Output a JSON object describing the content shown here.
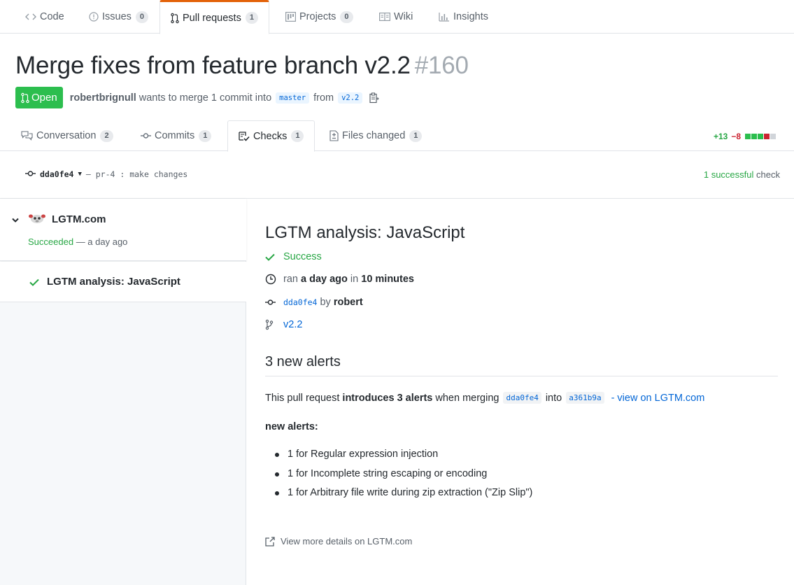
{
  "repo_nav": {
    "tabs": [
      {
        "label": "Code",
        "icon": "code-icon",
        "count": null
      },
      {
        "label": "Issues",
        "icon": "issue-icon",
        "count": "0"
      },
      {
        "label": "Pull requests",
        "icon": "pull-request-icon",
        "count": "1",
        "selected": true
      },
      {
        "label": "Projects",
        "icon": "project-icon",
        "count": "0"
      },
      {
        "label": "Wiki",
        "icon": "book-icon",
        "count": null
      },
      {
        "label": "Insights",
        "icon": "graph-icon",
        "count": null
      }
    ]
  },
  "pr": {
    "title": "Merge fixes from feature branch v2.2",
    "number": "#160",
    "state": "Open",
    "author": "robertbrignull",
    "merge_text": "wants to merge 1 commit into",
    "base_branch": "master",
    "from_text": "from",
    "head_branch": "v2.2"
  },
  "pr_tabs": [
    {
      "label": "Conversation",
      "icon": "comment-discussion-icon",
      "count": "2"
    },
    {
      "label": "Commits",
      "icon": "git-commit-icon",
      "count": "1"
    },
    {
      "label": "Checks",
      "icon": "checklist-icon",
      "count": "1",
      "selected": true
    },
    {
      "label": "Files changed",
      "icon": "file-diff-icon",
      "count": "1"
    }
  ],
  "diffstat": {
    "additions": "+13",
    "deletions": "−8",
    "colors": {
      "add": "#2cbe4e",
      "del": "#cb2431",
      "neutral": "#d1d5da"
    }
  },
  "commit_bar": {
    "sha": "dda0fe4",
    "message": "— pr-4 : make changes",
    "success_count": "1 successful",
    "check_word": "check"
  },
  "sidebar": {
    "suite_name": "LGTM.com",
    "suite_status": "Succeeded",
    "suite_time": "— a day ago",
    "run_label": "LGTM analysis: JavaScript"
  },
  "detail": {
    "title": "LGTM analysis: JavaScript",
    "status": "Success",
    "ran_prefix": "ran",
    "ran_when": "a day ago",
    "ran_in": "in",
    "ran_duration": "10 minutes",
    "commit_sha": "dda0fe4",
    "commit_by": "by",
    "commit_author": "robert",
    "branch": "v2.2",
    "alerts_heading": "3 new alerts",
    "summary_prefix": "This pull request",
    "summary_bold": "introduces 3 alerts",
    "summary_mid": "when merging",
    "summary_head": "dda0fe4",
    "summary_into": "into",
    "summary_base": "a361b9a",
    "summary_link": "- view on LGTM.com",
    "new_alerts_label": "new alerts:",
    "alerts": [
      "1 for Regular expression injection",
      "1 for Incomplete string escaping or encoding",
      "1 for Arbitrary file write during zip extraction (\"Zip Slip\")"
    ],
    "more_details": "View more details on LGTM.com"
  },
  "colors": {
    "accent_orange": "#e36209",
    "success_green": "#28a745",
    "link_blue": "#0366d6",
    "badge_green": "#2cbe4e"
  }
}
